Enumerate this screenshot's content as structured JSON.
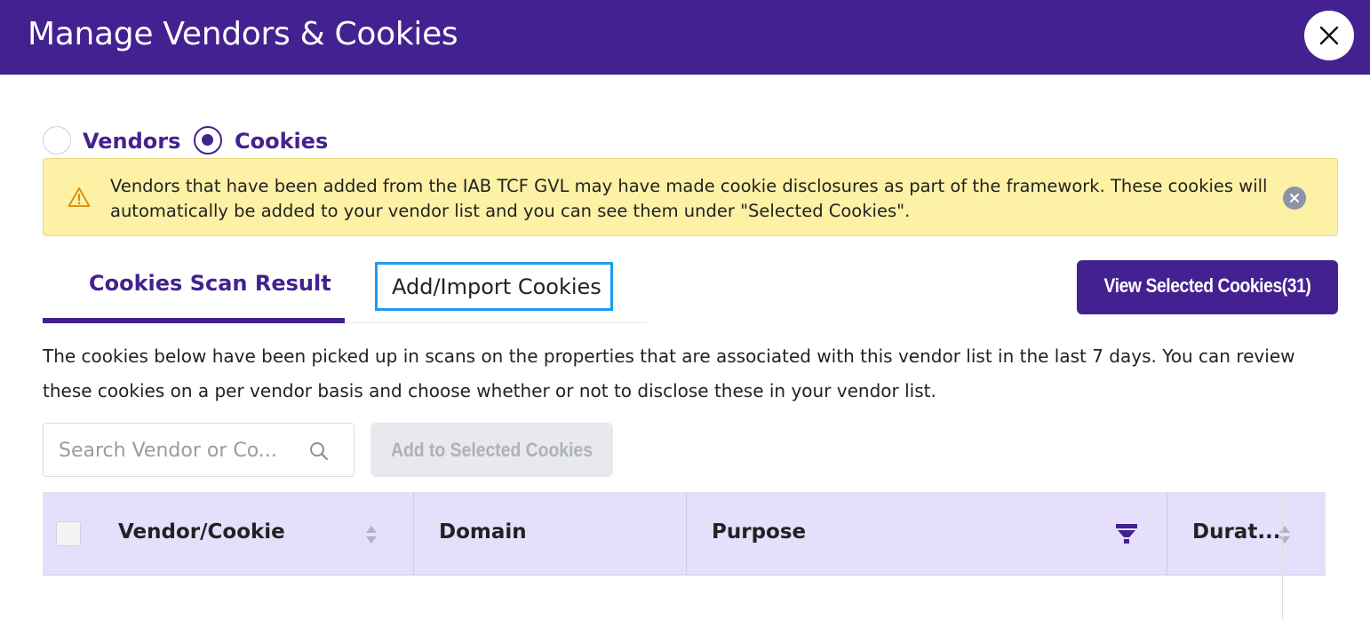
{
  "header": {
    "title": "Manage Vendors & Cookies",
    "close_icon": "close-icon"
  },
  "mode": {
    "options": [
      {
        "label": "Vendors",
        "selected": false
      },
      {
        "label": "Cookies",
        "selected": true
      }
    ]
  },
  "notice": {
    "icon": "warning-icon",
    "text": "Vendors that have been added from the IAB TCF GVL may have made cookie disclosures as part of the framework. These cookies will automatically be added to your vendor list and you can see them under \"Selected Cookies\".",
    "bg_color": "#fdf1a6"
  },
  "tabs": [
    {
      "label": "Cookies Scan Result",
      "active": true
    },
    {
      "label": "Add/Import Cookies",
      "active": false,
      "highlighted": true
    }
  ],
  "view_selected_button": {
    "label": "View Selected Cookies(31)"
  },
  "description": "The cookies below have been picked up in scans on the properties that are associated with this vendor list in the last 7 days. You can review these cookies on a per vendor basis and choose whether or not to disclose these in your vendor list.",
  "search": {
    "placeholder": "Search Vendor or Co...",
    "value": ""
  },
  "add_button": {
    "label": "Add to Selected Cookies",
    "disabled": true
  },
  "table": {
    "columns": [
      {
        "label": "Vendor/Cookie",
        "sortable": true
      },
      {
        "label": "Domain",
        "sortable": false
      },
      {
        "label": "Purpose",
        "filterable": true
      },
      {
        "label": "Durat...",
        "sortable": true
      }
    ]
  },
  "colors": {
    "brand": "#442190",
    "focus_outline": "#1d9bf0",
    "table_header": "#e5dffb"
  }
}
